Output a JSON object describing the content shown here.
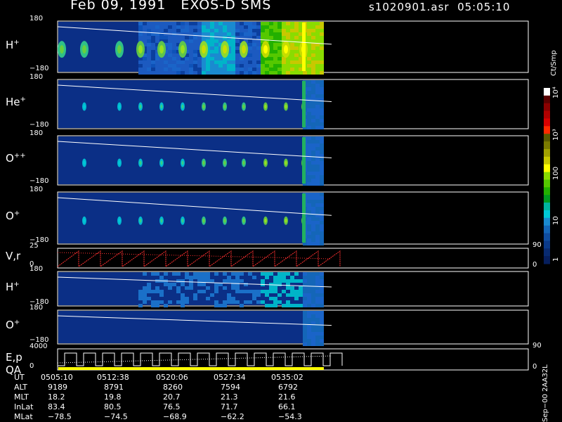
{
  "header": {
    "title_left": "Feb 09, 1991   EXOS-D SMS",
    "title_right": "s1020901.asr  05:05:10"
  },
  "colorbar": {
    "unit": "Ct/Smp",
    "ticks": [
      "10⁴",
      "10³",
      "100",
      "10",
      "1"
    ],
    "colors": [
      "#ffffff",
      "#5a0000",
      "#8a0000",
      "#b00000",
      "#d80000",
      "#ff2a00",
      "#5a5a00",
      "#7a7a00",
      "#a0a000",
      "#c8c800",
      "#ffff00",
      "#8adc00",
      "#55c800",
      "#22b000",
      "#009a20",
      "#00b4a0",
      "#00c8d8",
      "#1a8ad0",
      "#1466b8",
      "#0f4da0",
      "#0a3a8a",
      "#082a70",
      "#061e5c"
    ]
  },
  "footer_rows": {
    "labels": [
      "UT",
      "ALT",
      "MLT",
      "InLat",
      "MLat"
    ],
    "columns": [
      [
        "0505:10",
        "9189",
        "18.2",
        "83.4",
        "−78.5"
      ],
      [
        "0512:38",
        "8791",
        "19.8",
        "80.5",
        "−74.5"
      ],
      [
        "0520:06",
        "8260",
        "20.7",
        "76.5",
        "−68.9"
      ],
      [
        "0527:34",
        "7594",
        "21.3",
        "71.7",
        "−62.2"
      ],
      [
        "0535:02",
        "6792",
        "21.6",
        "66.1",
        "−54.3"
      ]
    ]
  },
  "side_note": "Sep−00  2AA32L",
  "chart_data": [
    {
      "type": "heatmap",
      "name": "H+",
      "label_base": "H",
      "label_sup": "+",
      "ylim": [
        -180,
        180
      ],
      "ytick_labels": [
        "180",
        "−180"
      ]
    },
    {
      "type": "heatmap",
      "name": "He+",
      "label_base": "He",
      "label_sup": "+",
      "ylim": [
        -180,
        180
      ],
      "ytick_labels": [
        "180",
        "−180"
      ]
    },
    {
      "type": "heatmap",
      "name": "O++",
      "label_base": "O",
      "label_sup": "++",
      "ylim": [
        -180,
        180
      ],
      "ytick_labels": [
        "180",
        "−180"
      ]
    },
    {
      "type": "heatmap",
      "name": "O+",
      "label_base": "O",
      "label_sup": "+",
      "ylim": [
        -180,
        180
      ],
      "ytick_labels": [
        "180",
        "−180"
      ]
    },
    {
      "type": "line",
      "name": "V,r",
      "label_base": "V,r",
      "label_sup": "",
      "ylim": [
        0,
        25
      ],
      "ytick_labels": [
        "25",
        "0"
      ],
      "right_ticks": [
        "90",
        "0"
      ]
    },
    {
      "type": "heatmap",
      "name": "H+ (energy)",
      "label_base": "H",
      "label_sup": "+",
      "ylim": [
        -180,
        180
      ],
      "ytick_labels": [
        "180",
        "−180"
      ]
    },
    {
      "type": "heatmap",
      "name": "O+ (energy)",
      "label_base": "O",
      "label_sup": "+",
      "ylim": [
        -180,
        180
      ],
      "ytick_labels": [
        "180",
        "−180"
      ]
    },
    {
      "type": "line",
      "name": "E,p / QA",
      "label_base": "E,p",
      "label_sub": "QA",
      "ylim": [
        0,
        4000
      ],
      "ytick_labels": [
        "4000",
        "0"
      ],
      "right_ticks": [
        "90",
        "0"
      ]
    }
  ]
}
